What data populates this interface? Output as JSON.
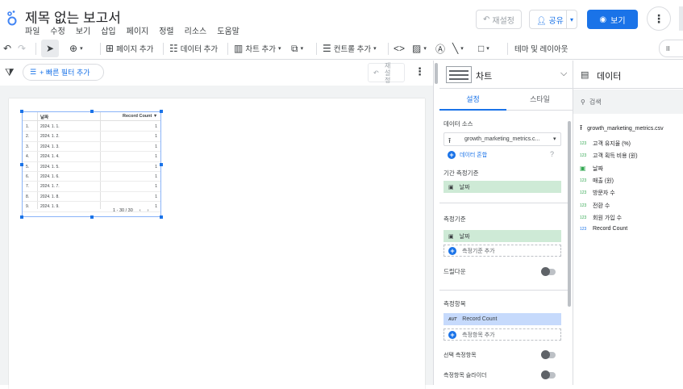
{
  "header": {
    "title": "제목 없는 보고서",
    "menu": [
      "파일",
      "수정",
      "보기",
      "삽입",
      "페이지",
      "정렬",
      "리소스",
      "도움말"
    ],
    "reset_label": "재설정",
    "share_label": "공유",
    "view_label": "보기",
    "brand_color": "#1a73e8"
  },
  "toolbar": {
    "add_page": "페이지 추가",
    "add_data": "데이터 추가",
    "add_chart": "차트 추가",
    "add_control": "컨트롤 추가",
    "theme_layout": "테마 및 레이아웃",
    "pause_label": "II"
  },
  "filter_bar": {
    "quick_filter": "+ 빠른 필터 추가",
    "reset_chars": [
      "재",
      "설",
      "정"
    ]
  },
  "table": {
    "col_date": "날짜",
    "col_metric": "Record Count",
    "sort_indicator": "▼",
    "rows": [
      {
        "n": "1.",
        "date": "2024. 1. 1.",
        "value": "1"
      },
      {
        "n": "2.",
        "date": "2024. 1. 2.",
        "value": "1"
      },
      {
        "n": "3.",
        "date": "2024. 1. 3.",
        "value": "1"
      },
      {
        "n": "4.",
        "date": "2024. 1. 4.",
        "value": "1"
      },
      {
        "n": "5.",
        "date": "2024. 1. 5.",
        "value": "1"
      },
      {
        "n": "6.",
        "date": "2024. 1. 6.",
        "value": "1"
      },
      {
        "n": "7.",
        "date": "2024. 1. 7.",
        "value": "1"
      },
      {
        "n": "8.",
        "date": "2024. 1. 8.",
        "value": "1"
      },
      {
        "n": "9.",
        "date": "2024. 1. 9.",
        "value": "1"
      }
    ],
    "pager": "1 - 30 / 30"
  },
  "chart_panel": {
    "title": "차트",
    "tab_setup": "설정",
    "tab_style": "스타일",
    "data_source_label": "데이터 소스",
    "data_source_value": "growth_marketing_metrics.c...",
    "blend_label": "데이터 혼합",
    "date_range_dim_label": "기간 측정기준",
    "date_range_dim_value": "날짜",
    "dimension_label": "측정기준",
    "dimension_value": "날짜",
    "add_dimension": "측정기준 추가",
    "drilldown_label": "드릴다운",
    "metric_label": "측정항목",
    "metric_type": "AUT",
    "metric_value": "Record Count",
    "add_metric": "측정항목 추가",
    "optional_metrics": "선택 측정항목",
    "metric_slider": "측정항목 슬라이더"
  },
  "data_panel": {
    "title": "데이터",
    "search_placeholder": "검색",
    "source_name": "growth_marketing_metrics.csv",
    "fields": [
      {
        "type": "123",
        "name": "고객 유지율 (%)",
        "kind": "dim"
      },
      {
        "type": "123",
        "name": "고객 획득 비용 (원)",
        "kind": "dim"
      },
      {
        "type": "cal",
        "name": "날짜",
        "kind": "dim"
      },
      {
        "type": "123",
        "name": "매출 (원)",
        "kind": "dim"
      },
      {
        "type": "123",
        "name": "방문자 수",
        "kind": "dim"
      },
      {
        "type": "123",
        "name": "전환 수",
        "kind": "dim"
      },
      {
        "type": "123",
        "name": "회원 가입 수",
        "kind": "dim"
      },
      {
        "type": "123",
        "name": "Record Count",
        "kind": "metric"
      }
    ]
  }
}
